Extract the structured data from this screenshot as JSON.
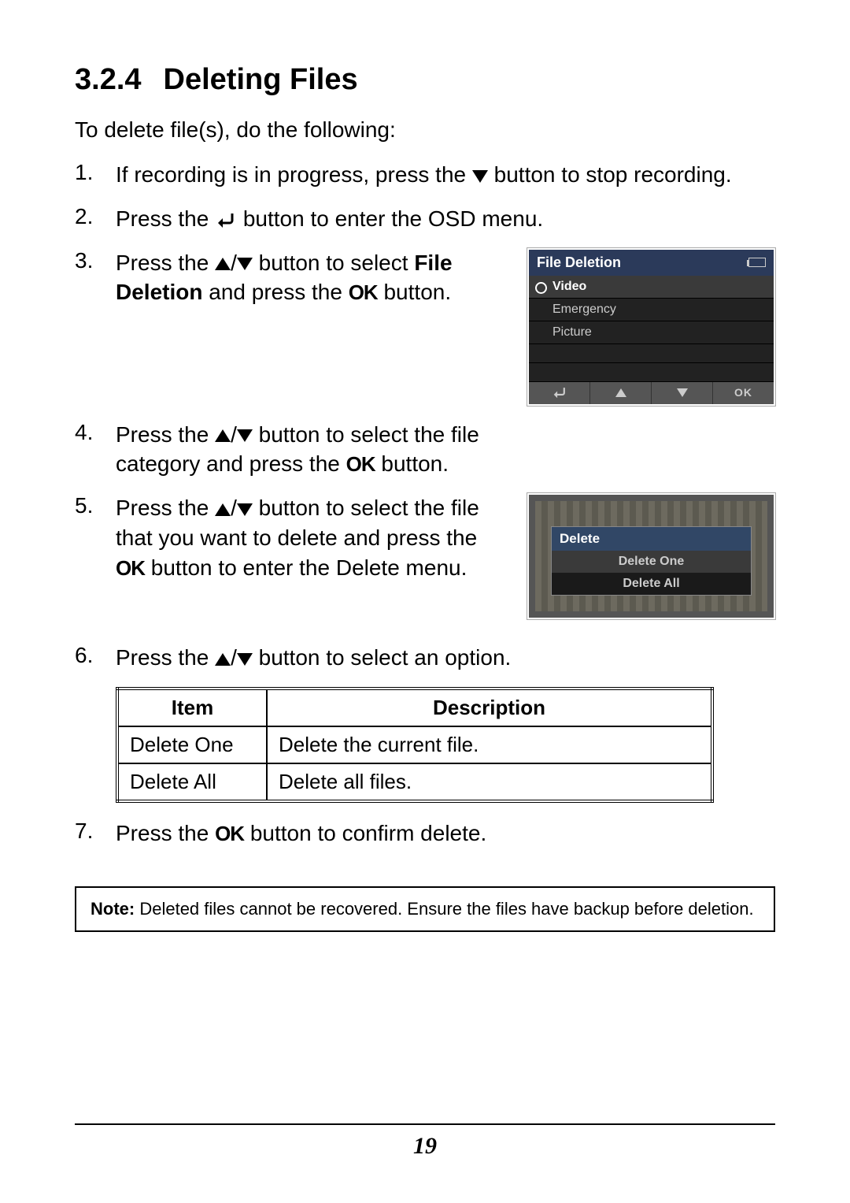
{
  "heading": {
    "number": "3.2.4",
    "title": "Deleting Files"
  },
  "intro": "To delete file(s), do the following:",
  "steps": {
    "s1": {
      "num": "1.",
      "pre": "If recording is in progress, press the ",
      "post": " button to stop recording."
    },
    "s2": {
      "num": "2.",
      "pre": "Press the ",
      "post": " button to enter the OSD menu."
    },
    "s3": {
      "num": "3.",
      "pre": "Press the ",
      "mid": " button to select ",
      "bold": "File Deletion",
      "mid2": " and press the ",
      "ok": "OK",
      "post": " button."
    },
    "s4": {
      "num": "4.",
      "pre": "Press the ",
      "mid": " button to select the file category and press the ",
      "ok": "OK",
      "post": " button."
    },
    "s5": {
      "num": "5.",
      "pre": "Press the ",
      "mid": " button to select the file that you want to delete and press the ",
      "ok": "OK",
      "post": " button to enter the Delete menu."
    },
    "s6": {
      "num": "6.",
      "pre": "Press the ",
      "post": " button to select an option."
    },
    "s7": {
      "num": "7.",
      "pre": "Press the ",
      "ok": "OK",
      "post": " button to confirm delete."
    }
  },
  "osd": {
    "title": "File Deletion",
    "items": [
      "Video",
      "Emergency",
      "Picture"
    ],
    "ok": "OK"
  },
  "delete_panel": {
    "title": "Delete",
    "opts": [
      "Delete One",
      "Delete All"
    ]
  },
  "table": {
    "head": {
      "item": "Item",
      "desc": "Description"
    },
    "rows": [
      {
        "item": "Delete One",
        "desc": "Delete the current file."
      },
      {
        "item": "Delete All",
        "desc": "Delete all files."
      }
    ]
  },
  "note": {
    "label": "Note:",
    "text": " Deleted files cannot be recovered. Ensure the files have backup before deletion."
  },
  "page_number": "19"
}
